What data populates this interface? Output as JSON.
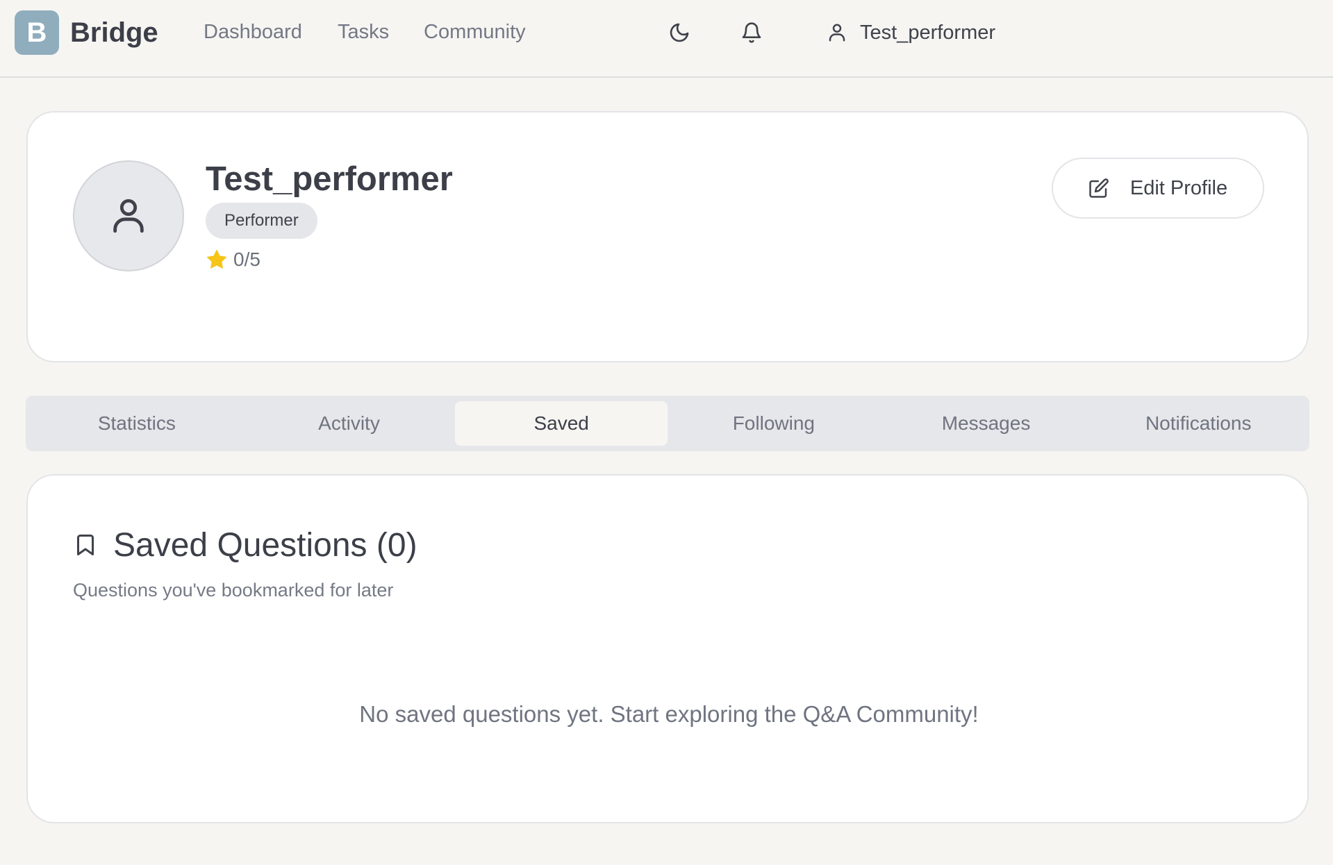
{
  "header": {
    "logo_letter": "B",
    "brand": "Bridge",
    "nav": [
      {
        "label": "Dashboard"
      },
      {
        "label": "Tasks"
      },
      {
        "label": "Community"
      }
    ],
    "icons": {
      "theme": "moon-icon",
      "notifications": "bell-icon",
      "user": "user-icon"
    },
    "user_name": "Test_performer"
  },
  "profile": {
    "name": "Test_performer",
    "role": "Performer",
    "rating": "0/5",
    "edit_label": "Edit Profile"
  },
  "tabs": [
    {
      "label": "Statistics",
      "active": false
    },
    {
      "label": "Activity",
      "active": false
    },
    {
      "label": "Saved",
      "active": true
    },
    {
      "label": "Following",
      "active": false
    },
    {
      "label": "Messages",
      "active": false
    },
    {
      "label": "Notifications",
      "active": false
    }
  ],
  "saved": {
    "title": "Saved Questions (0)",
    "subtitle": "Questions you've bookmarked for later",
    "empty_message": "No saved questions yet. Start exploring the Q&A Community!"
  },
  "colors": {
    "background": "#f6f5f2",
    "logo": "#8fadbd",
    "star": "#f5c518",
    "text": "#3f424b",
    "muted": "#737884"
  }
}
